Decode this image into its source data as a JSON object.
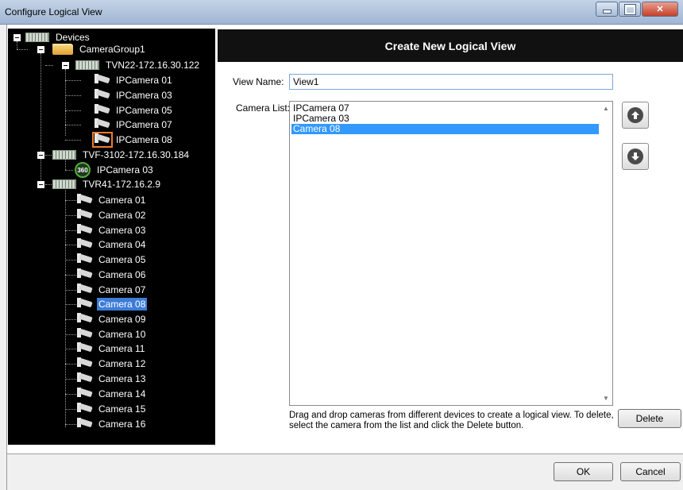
{
  "window": {
    "title": "Configure Logical View"
  },
  "tree": {
    "root": "Devices",
    "group": "CameraGroup1",
    "devices": [
      {
        "label": "TVN22-172.16.30.122",
        "cameras": [
          "IPCamera 01",
          "IPCamera 03",
          "IPCamera 05",
          "IPCamera 07",
          "IPCamera 08"
        ]
      },
      {
        "label": "TVF-3102-172.16.30.184",
        "cameras": [
          "IPCamera 03"
        ]
      },
      {
        "label": "TVR41-172.16.2.9",
        "cameras": [
          "Camera 01",
          "Camera 02",
          "Camera 03",
          "Camera 04",
          "Camera 05",
          "Camera 06",
          "Camera 07",
          "Camera 08",
          "Camera 09",
          "Camera 10",
          "Camera 11",
          "Camera 12",
          "Camera 13",
          "Camera 14",
          "Camera 15",
          "Camera 16"
        ]
      }
    ],
    "selected": "Camera 08",
    "icon_360": "360"
  },
  "panel": {
    "header": "Create New Logical View",
    "view_name_label": "View Name:",
    "view_name_value": "View1",
    "camera_list_label": "Camera List:",
    "camera_list": [
      "IPCamera 07",
      "IPCamera 03",
      "Camera 08"
    ],
    "camera_list_selected": "Camera 08",
    "hint": "Drag and drop cameras from different devices to create a logical view.  To delete, select the camera from the list and click the Delete button.",
    "delete_label": "Delete"
  },
  "footer": {
    "ok_label": "OK",
    "cancel_label": "Cancel"
  },
  "colors": {
    "selection": "#3399ff",
    "tree_background": "#000000",
    "header_background": "#111111",
    "highlight_box": "#ee7d2a"
  }
}
